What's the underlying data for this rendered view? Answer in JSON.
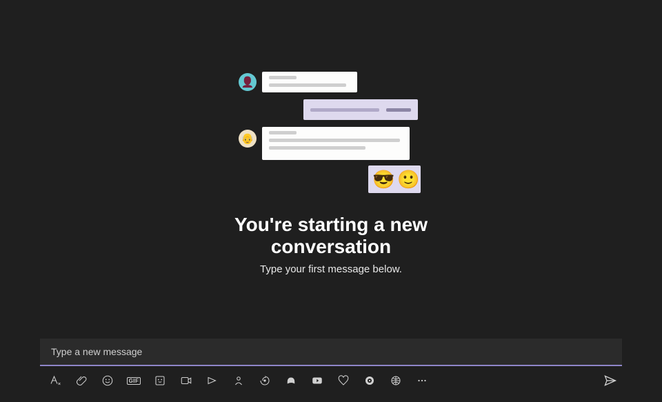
{
  "empty_state": {
    "heading": "You're starting a new conversation",
    "subheading": "Type your first message below.",
    "emoji_1": "😎",
    "emoji_2": "🙂"
  },
  "compose": {
    "placeholder": "Type a new message",
    "value": ""
  },
  "toolbar": {
    "format": "Format",
    "attach": "Attach",
    "emoji": "Emoji",
    "gif": "GIF",
    "sticker": "Sticker",
    "meet": "Schedule a meeting",
    "stream": "Stream",
    "viva": "Viva",
    "forms": "Forms",
    "youtube": "YouTube",
    "praise": "Praise",
    "app1": "App",
    "app2": "App",
    "more": "More options",
    "send": "Send"
  }
}
